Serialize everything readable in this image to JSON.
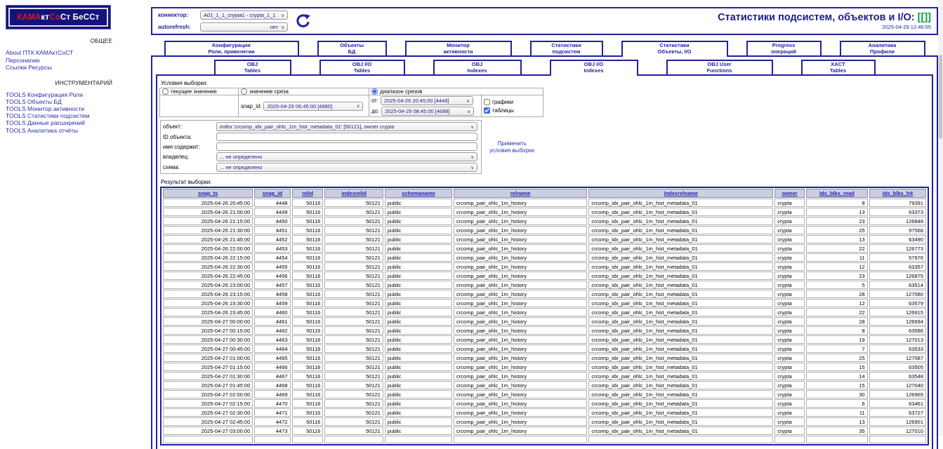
{
  "logo": {
    "part1": "КАМА",
    "part2": "кт",
    "part3": "Со",
    "part4": "Ст БеССт"
  },
  "sidebar": {
    "section1_title": "ОБЩЕЕ",
    "section1_links": [
      "About ПТК КАМАктСоСТ",
      "Персоналии",
      "Ссылки Ресурсы"
    ],
    "section2_title": "ИНСТРУМЕНТАРИЙ",
    "section2_links": [
      "TOOLS Конфигурация Роли",
      "TOOLS Объекты БД",
      "TOOLS Монитор активности",
      "TOOLS Статистики подсистем",
      "TOOLS Данные расширений",
      "TOOLS Аналитика отчёты"
    ]
  },
  "header": {
    "connector_label": "коннектор:",
    "connector_value": "A01_1_1_crypta1 - crypta_1_1",
    "autorefresh_label": "autorefresh:",
    "autorefresh_value": "нет",
    "title": "Статистики подсистем, объектов и I/O:",
    "title_suffix": "[[]]",
    "timestamp": "2025-04-29 12:46:55"
  },
  "icons": {
    "refresh": "circular-arrow-refresh",
    "dropdown_arrow": "∨",
    "accent_navy": "#22229b",
    "accent_green": "#00a13e",
    "link_blue": "#2b2ba8"
  },
  "tabs_row1": [
    {
      "line1": "Конфигурация",
      "line2": "Роли, привелегии",
      "active": false
    },
    {
      "line1": "Объекты",
      "line2": "БД",
      "active": false
    },
    {
      "line1": "Монитор",
      "line2": "активности",
      "active": false
    },
    {
      "line1": "Статистики",
      "line2": "подсистем",
      "active": false
    },
    {
      "line1": "Статистики",
      "line2": "Объекты, I/O",
      "active": true
    },
    {
      "line1": "Progress",
      "line2": "операций",
      "active": false
    },
    {
      "line1": "Аналитика",
      "line2": "Профили",
      "active": false
    }
  ],
  "tabs_row2": [
    {
      "line1": "OBJ",
      "line2": "Tables",
      "active": false
    },
    {
      "line1": "OBJ I/O",
      "line2": "Tables",
      "active": false
    },
    {
      "line1": "OBJ",
      "line2": "Indexes",
      "active": false
    },
    {
      "line1": "OBJ I/O",
      "line2": "Indexes",
      "active": true
    },
    {
      "line1": "OBJ User",
      "line2": "Functions",
      "active": false
    },
    {
      "line1": "XACT",
      "line2": "Tables",
      "active": false
    }
  ],
  "filter": {
    "title": "Условия выборки:",
    "radio_current": "текущее значение",
    "radio_slice": "значение среза",
    "radio_range": "диапазон срезов",
    "selected_radio": "диапазон срезов",
    "snap_id_label": "snap_id:",
    "snap_id_value": "2025-04-29 06:45:00 [4680]",
    "from_label": "от:",
    "from_value": "2025-04-26 20:45:00 [4448]",
    "to_label": "до:",
    "to_value": "2025-04-29 08:45:00 [4688]",
    "check_graphs": "графики",
    "check_graphs_checked": false,
    "check_tables": "таблицы",
    "check_tables_checked": true,
    "object_label": "объект:",
    "object_value": "index 'crcomp_idx_pair_ohlc_1m_hist_metadata_01' [50121], owner crypta",
    "object_id_label": "ID объекта:",
    "object_id_value": "",
    "name_contains_label": "имя содержит:",
    "name_contains_value": "",
    "owner_label": "владелец:",
    "owner_value": "... не определено",
    "schema_label": "схема:",
    "schema_value": "... не определено",
    "apply_link": "Применить условия выборки"
  },
  "result": {
    "title": "Результат выборки:",
    "columns": [
      "snap_ts",
      "snap_id",
      "relid",
      "indexrelid",
      "schemaname",
      "relname",
      "indexrelname",
      "owner",
      "idx_blks_read",
      "idx_blks_hit"
    ],
    "rows": [
      [
        "2025-04-26 20:45:00",
        "4448",
        "50116",
        "50121",
        "public",
        "crcomp_pair_ohlc_1m_history",
        "crcomp_idx_pair_ohlc_1m_hist_metadata_01",
        "crypta",
        "8",
        "79391"
      ],
      [
        "2025-04-26 21:00:00",
        "4449",
        "50116",
        "50121",
        "public",
        "crcomp_pair_ohlc_1m_history",
        "crcomp_idx_pair_ohlc_1m_hist_metadata_01",
        "crypta",
        "13",
        "63373"
      ],
      [
        "2025-04-26 21:15:00",
        "4450",
        "50116",
        "50121",
        "public",
        "crcomp_pair_ohlc_1m_history",
        "crcomp_idx_pair_ohlc_1m_hist_metadata_01",
        "crypta",
        "23",
        "126848"
      ],
      [
        "2025-04-26 21:30:00",
        "4451",
        "50116",
        "50121",
        "public",
        "crcomp_pair_ohlc_1m_history",
        "crcomp_idx_pair_ohlc_1m_hist_metadata_01",
        "crypta",
        "25",
        "97568"
      ],
      [
        "2025-04-26 21:45:00",
        "4452",
        "50116",
        "50121",
        "public",
        "crcomp_pair_ohlc_1m_history",
        "crcomp_idx_pair_ohlc_1m_hist_metadata_01",
        "crypta",
        "13",
        "63490"
      ],
      [
        "2025-04-26 22:00:00",
        "4453",
        "50116",
        "50121",
        "public",
        "crcomp_pair_ohlc_1m_history",
        "crcomp_idx_pair_ohlc_1m_hist_metadata_01",
        "crypta",
        "22",
        "126773"
      ],
      [
        "2025-04-26 22:15:00",
        "4454",
        "50116",
        "50121",
        "public",
        "crcomp_pair_ohlc_1m_history",
        "crcomp_idx_pair_ohlc_1m_hist_metadata_01",
        "crypta",
        "11",
        "57976"
      ],
      [
        "2025-04-26 22:30:00",
        "4455",
        "50116",
        "50121",
        "public",
        "crcomp_pair_ohlc_1m_history",
        "crcomp_idx_pair_ohlc_1m_hist_metadata_01",
        "crypta",
        "12",
        "63357"
      ],
      [
        "2025-04-26 22:45:00",
        "4456",
        "50116",
        "50121",
        "public",
        "crcomp_pair_ohlc_1m_history",
        "crcomp_idx_pair_ohlc_1m_hist_metadata_01",
        "crypta",
        "23",
        "126875"
      ],
      [
        "2025-04-26 23:00:00",
        "4457",
        "50116",
        "50121",
        "public",
        "crcomp_pair_ohlc_1m_history",
        "crcomp_idx_pair_ohlc_1m_hist_metadata_01",
        "crypta",
        "5",
        "63514"
      ],
      [
        "2025-04-26 23:15:00",
        "4458",
        "50116",
        "50121",
        "public",
        "crcomp_pair_ohlc_1m_history",
        "crcomp_idx_pair_ohlc_1m_hist_metadata_01",
        "crypta",
        "28",
        "127080"
      ],
      [
        "2025-04-26 23:30:00",
        "4459",
        "50116",
        "50121",
        "public",
        "crcomp_pair_ohlc_1m_history",
        "crcomp_idx_pair_ohlc_1m_hist_metadata_01",
        "crypta",
        "12",
        "63579"
      ],
      [
        "2025-04-26 23:45:00",
        "4460",
        "50116",
        "50121",
        "public",
        "crcomp_pair_ohlc_1m_history",
        "crcomp_idx_pair_ohlc_1m_hist_metadata_01",
        "crypta",
        "22",
        "126915"
      ],
      [
        "2025-04-27 00:00:00",
        "4461",
        "50116",
        "50121",
        "public",
        "crcomp_pair_ohlc_1m_history",
        "crcomp_idx_pair_ohlc_1m_hist_metadata_01",
        "crypta",
        "28",
        "126694"
      ],
      [
        "2025-04-27 00:15:00",
        "4462",
        "50116",
        "50121",
        "public",
        "crcomp_pair_ohlc_1m_history",
        "crcomp_idx_pair_ohlc_1m_hist_metadata_01",
        "crypta",
        "8",
        "63586"
      ],
      [
        "2025-04-27 00:30:00",
        "4463",
        "50116",
        "50121",
        "public",
        "crcomp_pair_ohlc_1m_history",
        "crcomp_idx_pair_ohlc_1m_hist_metadata_01",
        "crypta",
        "19",
        "127013"
      ],
      [
        "2025-04-27 00:45:00",
        "4464",
        "50116",
        "50121",
        "public",
        "crcomp_pair_ohlc_1m_history",
        "crcomp_idx_pair_ohlc_1m_hist_metadata_01",
        "crypta",
        "7",
        "63533"
      ],
      [
        "2025-04-27 01:00:00",
        "4465",
        "50116",
        "50121",
        "public",
        "crcomp_pair_ohlc_1m_history",
        "crcomp_idx_pair_ohlc_1m_hist_metadata_01",
        "crypta",
        "25",
        "127087"
      ],
      [
        "2025-04-27 01:15:00",
        "4466",
        "50116",
        "50121",
        "public",
        "crcomp_pair_ohlc_1m_history",
        "crcomp_idx_pair_ohlc_1m_hist_metadata_01",
        "crypta",
        "15",
        "63505"
      ],
      [
        "2025-04-27 01:30:00",
        "4467",
        "50116",
        "50121",
        "public",
        "crcomp_pair_ohlc_1m_history",
        "crcomp_idx_pair_ohlc_1m_hist_metadata_01",
        "crypta",
        "14",
        "63548"
      ],
      [
        "2025-04-27 01:45:00",
        "4468",
        "50116",
        "50121",
        "public",
        "crcomp_pair_ohlc_1m_history",
        "crcomp_idx_pair_ohlc_1m_hist_metadata_01",
        "crypta",
        "15",
        "127040"
      ],
      [
        "2025-04-27 02:00:00",
        "4469",
        "50116",
        "50121",
        "public",
        "crcomp_pair_ohlc_1m_history",
        "crcomp_idx_pair_ohlc_1m_hist_metadata_01",
        "crypta",
        "30",
        "126965"
      ],
      [
        "2025-04-27 02:15:00",
        "4470",
        "50116",
        "50121",
        "public",
        "crcomp_pair_ohlc_1m_history",
        "crcomp_idx_pair_ohlc_1m_hist_metadata_01",
        "crypta",
        "6",
        "63461"
      ],
      [
        "2025-04-27 02:30:00",
        "4471",
        "50116",
        "50121",
        "public",
        "crcomp_pair_ohlc_1m_history",
        "crcomp_idx_pair_ohlc_1m_hist_metadata_01",
        "crypta",
        "11",
        "63727"
      ],
      [
        "2025-04-27 02:45:00",
        "4472",
        "50116",
        "50121",
        "public",
        "crcomp_pair_ohlc_1m_history",
        "crcomp_idx_pair_ohlc_1m_hist_metadata_01",
        "crypta",
        "13",
        "126901"
      ],
      [
        "2025-04-27 03:00:00",
        "4473",
        "50116",
        "50121",
        "public",
        "crcomp_pair_ohlc_1m_history",
        "crcomp_idx_pair_ohlc_1m_hist_metadata_01",
        "crypta",
        "35",
        "127010"
      ]
    ]
  }
}
